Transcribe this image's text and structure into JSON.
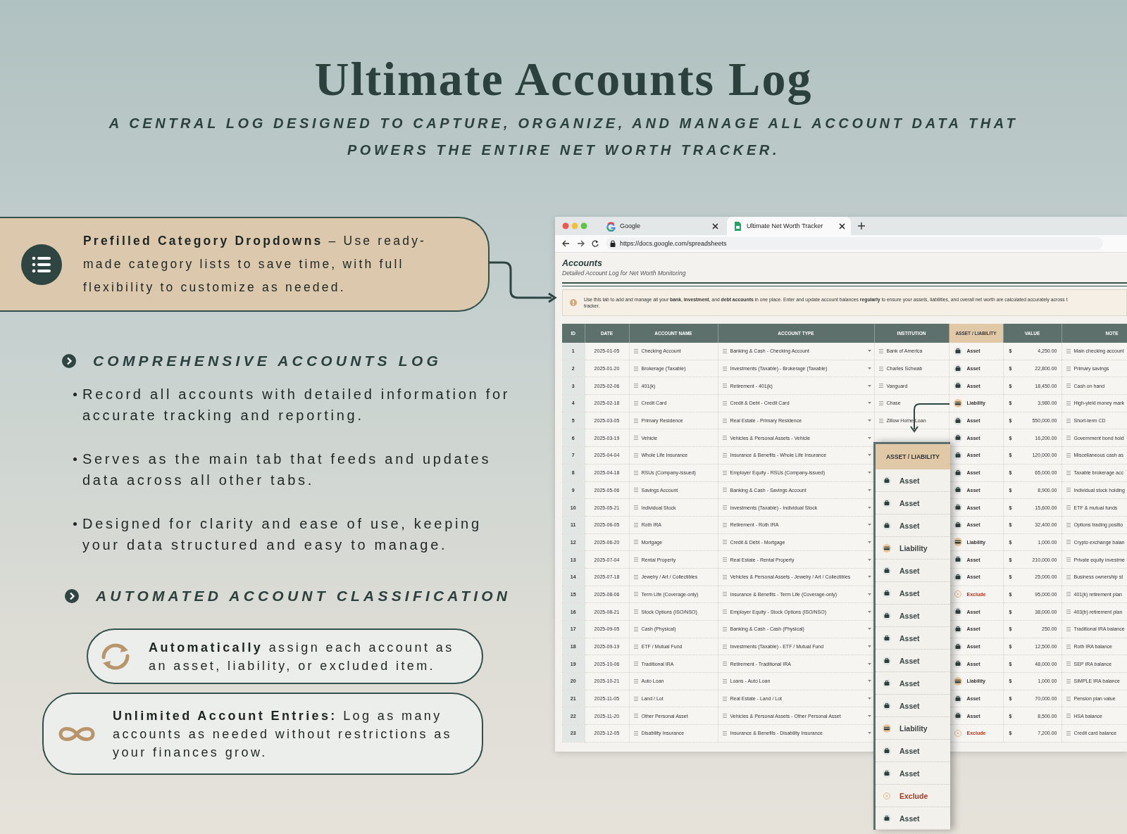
{
  "title": "Ultimate Accounts Log",
  "subtitle": "A CENTRAL LOG DESIGNED TO CAPTURE, ORGANIZE, AND MANAGE ALL ACCOUNT DATA THAT POWERS THE ENTIRE NET WORTH TRACKER.",
  "feature_banner": {
    "text": "**Prefilled Category Dropdowns** – Use ready-made category lists to save time, with full flexibility to customize as needed."
  },
  "sections": [
    {
      "heading": "COMPREHENSIVE ACCOUNTS LOG",
      "bullets": [
        "Record all accounts with detailed information for accurate tracking and reporting.",
        "Serves as the main tab that feeds and updates data across all other tabs.",
        "Designed for clarity and ease of use, keeping your data structured and easy to manage."
      ]
    },
    {
      "heading": "AUTOMATED ACCOUNT CLASSIFICATION"
    }
  ],
  "cards": [
    {
      "kind": "sync",
      "text": "**Automatically** assign each account as an asset, liability, or excluded item."
    },
    {
      "kind": "infinity",
      "text": "**Unlimited Account Entries:** Log as many accounts as needed without restrictions as your finances grow."
    }
  ],
  "browser": {
    "tabs": [
      {
        "kind": "google",
        "title": "Google",
        "selected": false
      },
      {
        "kind": "sheets",
        "title": "Ultimate Net Worth Tracker",
        "selected": true
      }
    ],
    "url": "https://docs.google.com/spreadsheets"
  },
  "sheet": {
    "title": "Accounts",
    "subtitle": "Detailed Account Log for Net Worth Monitoring",
    "notice_lines": [
      "Use this tab to add and manage all your **bank**, **investment**, and **debt accounts** in one place. Enter and update account balances **regularly** to ensure your assets, liabilities, and overall net worth are calculated accurately across t",
      "tracker."
    ],
    "columns": [
      {
        "label": "ID",
        "highlighted": false
      },
      {
        "label": "DATE",
        "highlighted": false
      },
      {
        "label": "ACCOUNT NAME",
        "highlighted": false
      },
      {
        "label": "ACCOUNT TYPE",
        "highlighted": false
      },
      {
        "label": "INSTITUTION",
        "highlighted": false
      },
      {
        "label": "ASSET / LIABILITY",
        "highlighted": true
      },
      {
        "label": "VALUE",
        "highlighted": false
      },
      {
        "label": "NOTE",
        "highlighted": false
      }
    ],
    "rows": [
      {
        "id": "1",
        "date": "2025-01-05",
        "account_name": "Checking Account",
        "account_type": "Banking & Cash - Checking Account",
        "institution": "Bank of America",
        "classification": {
          "kind": "asset",
          "label": "Asset"
        },
        "currency": "$",
        "value": "4,250.00",
        "note": "Main checking account"
      },
      {
        "id": "2",
        "date": "2025-01-20",
        "account_name": "Brokerage (Taxable)",
        "account_type": "Investments (Taxable) - Brokerage (Taxable)",
        "institution": "Charles Schwab",
        "classification": {
          "kind": "asset",
          "label": "Asset"
        },
        "currency": "$",
        "value": "22,800.00",
        "note": "Primary savings"
      },
      {
        "id": "3",
        "date": "2025-02-06",
        "account_name": "401(k)",
        "account_type": "Retirement - 401(k)",
        "institution": "Vanguard",
        "classification": {
          "kind": "asset",
          "label": "Asset"
        },
        "currency": "$",
        "value": "18,450.00",
        "note": "Cash on hand"
      },
      {
        "id": "4",
        "date": "2025-02-18",
        "account_name": "Credit Card",
        "account_type": "Credit & Debt - Credit Card",
        "institution": "Chase",
        "classification": {
          "kind": "liability",
          "label": "Liability"
        },
        "currency": "$",
        "value": "3,980.00",
        "note": "High-yield money mark"
      },
      {
        "id": "5",
        "date": "2025-03-05",
        "account_name": "Primary Residence",
        "account_type": "Real Estate - Primary Residence",
        "institution": "Zillow Home Loan",
        "classification": {
          "kind": "asset",
          "label": "Asset"
        },
        "currency": "$",
        "value": "550,000.00",
        "note": "Short-term CD"
      },
      {
        "id": "6",
        "date": "2025-03-19",
        "account_name": "Vehicle",
        "account_type": "Vehicles & Personal Assets - Vehicle",
        "classification": {
          "kind": "asset",
          "label": "Asset"
        },
        "currency": "$",
        "value": "16,200.00",
        "note": "Government bond hold"
      },
      {
        "id": "7",
        "date": "2025-04-04",
        "account_name": "Whole Life Insurance",
        "account_type": "Insurance & Benefits - Whole Life Insurance",
        "classification": {
          "kind": "asset",
          "label": "Asset"
        },
        "currency": "$",
        "value": "120,000.00",
        "note": "Miscellaneous cash as"
      },
      {
        "id": "8",
        "date": "2025-04-18",
        "account_name": "RSUs (Company-issued)",
        "account_type": "Employer Equity - RSUs (Company-issued)",
        "classification": {
          "kind": "asset",
          "label": "Asset"
        },
        "currency": "$",
        "value": "65,000.00",
        "note": "Taxable brokerage acc"
      },
      {
        "id": "9",
        "date": "2025-05-06",
        "account_name": "Savings Account",
        "account_type": "Banking & Cash - Savings Account",
        "classification": {
          "kind": "asset",
          "label": "Asset"
        },
        "currency": "$",
        "value": "8,900.00",
        "note": "Individual stock holding"
      },
      {
        "id": "10",
        "date": "2025-05-21",
        "account_name": "Individual Stock",
        "account_type": "Investments (Taxable) - Individual Stock",
        "classification": {
          "kind": "asset",
          "label": "Asset"
        },
        "currency": "$",
        "value": "15,600.00",
        "note": "ETF & mutual funds"
      },
      {
        "id": "11",
        "date": "2025-06-05",
        "account_name": "Roth IRA",
        "account_type": "Retirement - Roth IRA",
        "classification": {
          "kind": "asset",
          "label": "Asset"
        },
        "currency": "$",
        "value": "32,400.00",
        "note": "Options trading positio"
      },
      {
        "id": "12",
        "date": "2025-06-20",
        "account_name": "Mortgage",
        "account_type": "Credit & Debt - Mortgage",
        "classification": {
          "kind": "liability",
          "label": "Liability"
        },
        "currency": "$",
        "value": "1,000.00",
        "note": "Crypto exchange balan"
      },
      {
        "id": "13",
        "date": "2025-07-04",
        "account_name": "Rental Property",
        "account_type": "Real Estate - Rental Property",
        "classification": {
          "kind": "asset",
          "label": "Asset"
        },
        "currency": "$",
        "value": "210,000.00",
        "note": "Private equity investme"
      },
      {
        "id": "14",
        "date": "2025-07-18",
        "account_name": "Jewelry / Art / Collectibles",
        "account_type": "Vehicles & Personal Assets - Jewelry / Art / Collectibles",
        "classification": {
          "kind": "asset",
          "label": "Asset"
        },
        "currency": "$",
        "value": "25,000.00",
        "note": "Business ownership st"
      },
      {
        "id": "15",
        "date": "2025-08-06",
        "account_name": "Term Life (Coverage-only)",
        "account_type": "Insurance & Benefits - Term Life (Coverage-only)",
        "classification": {
          "kind": "exclude",
          "label": "Exclude"
        },
        "currency": "$",
        "value": "95,000.00",
        "note": "401(k) retirement plan"
      },
      {
        "id": "16",
        "date": "2025-08-21",
        "account_name": "Stock Options (ISO/NSO)",
        "account_type": "Employer Equity - Stock Options (ISO/NSO)",
        "classification": {
          "kind": "asset",
          "label": "Asset"
        },
        "currency": "$",
        "value": "38,000.00",
        "note": "403(b) retirement plan"
      },
      {
        "id": "17",
        "date": "2025-09-05",
        "account_name": "Cash (Physical)",
        "account_type": "Banking & Cash - Cash (Physical)",
        "classification": {
          "kind": "asset",
          "label": "Asset"
        },
        "currency": "$",
        "value": "250.00",
        "note": "Traditional IRA balance"
      },
      {
        "id": "18",
        "date": "2025-09-19",
        "account_name": "ETF / Mutual Fund",
        "account_type": "Investments (Taxable) - ETF / Mutual Fund",
        "classification": {
          "kind": "asset",
          "label": "Asset"
        },
        "currency": "$",
        "value": "12,500.00",
        "note": "Roth IRA balance"
      },
      {
        "id": "19",
        "date": "2025-10-06",
        "account_name": "Traditional IRA",
        "account_type": "Retirement - Traditional IRA",
        "classification": {
          "kind": "asset",
          "label": "Asset"
        },
        "currency": "$",
        "value": "48,000.00",
        "note": "SEP IRA balance"
      },
      {
        "id": "20",
        "date": "2025-10-21",
        "account_name": "Auto Loan",
        "account_type": "Loans - Auto Loan",
        "classification": {
          "kind": "liability",
          "label": "Liability"
        },
        "currency": "$",
        "value": "1,000.00",
        "note": "SIMPLE IRA balance"
      },
      {
        "id": "21",
        "date": "2025-11-05",
        "account_name": "Land / Lot",
        "account_type": "Real Estate - Land / Lot",
        "classification": {
          "kind": "asset",
          "label": "Asset"
        },
        "currency": "$",
        "value": "70,000.00",
        "note": "Pension plan value"
      },
      {
        "id": "22",
        "date": "2025-11-20",
        "account_name": "Other Personal Asset",
        "account_type": "Vehicles & Personal Assets - Other Personal Asset",
        "classification": {
          "kind": "asset",
          "label": "Asset"
        },
        "currency": "$",
        "value": "8,500.00",
        "note": "HSA balance"
      },
      {
        "id": "23",
        "date": "2025-12-05",
        "account_name": "Disability Insurance",
        "account_type": "Insurance & Benefits - Disability Insurance",
        "classification": {
          "kind": "exclude",
          "label": "Exclude"
        },
        "currency": "$",
        "value": "7,200.00",
        "note": "Credit card balance"
      }
    ]
  },
  "dropdown": {
    "header": "ASSET / LIABILITY",
    "options": [
      {
        "kind": "asset",
        "label": "Asset"
      },
      {
        "kind": "asset",
        "label": "Asset"
      },
      {
        "kind": "asset",
        "label": "Asset"
      },
      {
        "kind": "liability",
        "label": "Liability"
      },
      {
        "kind": "asset",
        "label": "Asset"
      },
      {
        "kind": "asset",
        "label": "Asset"
      },
      {
        "kind": "asset",
        "label": "Asset"
      },
      {
        "kind": "asset",
        "label": "Asset"
      },
      {
        "kind": "asset",
        "label": "Asset"
      },
      {
        "kind": "asset",
        "label": "Asset"
      },
      {
        "kind": "asset",
        "label": "Asset"
      },
      {
        "kind": "liability",
        "label": "Liability"
      },
      {
        "kind": "asset",
        "label": "Asset"
      },
      {
        "kind": "asset",
        "label": "Asset"
      },
      {
        "kind": "exclude",
        "label": "Exclude"
      },
      {
        "kind": "asset",
        "label": "Asset"
      }
    ]
  }
}
